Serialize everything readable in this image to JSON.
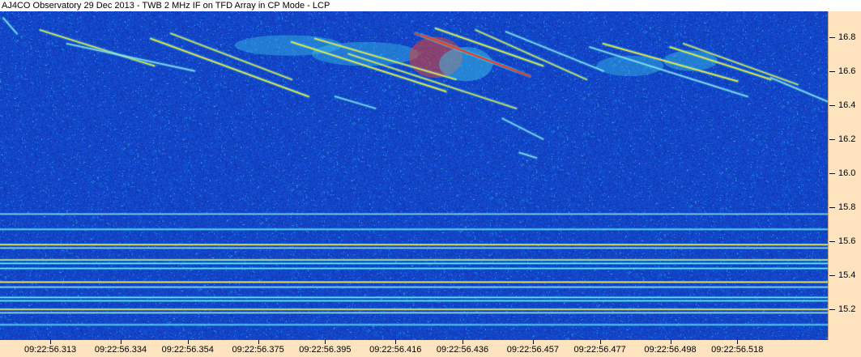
{
  "window": {
    "title": "AJ4CO Observatory 29 Dec 2013 - TWB 2 MHz IF on TFD Array in CP Mode - LCP"
  },
  "colors": {
    "background_blue": "#1a3fbf",
    "axis_panel": "#fde4bf",
    "emission_low": "#3cc8e6",
    "emission_mid": "#f0e640",
    "emission_high": "#e8402a"
  },
  "chart_data": {
    "type": "heatmap",
    "title": "AJ4CO Observatory 29 Dec 2013 - TWB 2 MHz IF on TFD Array in CP Mode - LCP",
    "xlabel": "",
    "ylabel": "",
    "x_ticks": [
      "09:22:56.313",
      "09:22:56.334",
      "09:22:56.354",
      "09:22:56.375",
      "09:22:56.395",
      "09:22:56.416",
      "09:22:56.436",
      "09:22:56.457",
      "09:22:56.477",
      "09:22:56.498",
      "09:22:56.518"
    ],
    "x_tick_seconds": [
      56.313,
      56.334,
      56.354,
      56.375,
      56.395,
      56.416,
      56.436,
      56.457,
      56.477,
      56.498,
      56.518
    ],
    "xlim": [
      56.298,
      56.545
    ],
    "y_ticks": [
      "15.2",
      "15.4",
      "15.6",
      "15.8",
      "16.0",
      "16.2",
      "16.4",
      "16.6",
      "16.8"
    ],
    "y_tick_values": [
      15.2,
      15.4,
      15.6,
      15.8,
      16.0,
      16.2,
      16.4,
      16.6,
      16.8
    ],
    "ylim": [
      15.02,
      16.95
    ],
    "y_units": "MHz",
    "grid": false,
    "colormap": "blue-cyan-yellow-red",
    "drifting_bursts": [
      {
        "t_start": 56.299,
        "f_start": 16.91,
        "t_end": 56.303,
        "f_end": 16.82,
        "intensity": 0.5
      },
      {
        "t_start": 56.31,
        "f_start": 16.84,
        "t_end": 56.344,
        "f_end": 16.63,
        "intensity": 0.7
      },
      {
        "t_start": 56.318,
        "f_start": 16.76,
        "t_end": 56.356,
        "f_end": 16.6,
        "intensity": 0.5
      },
      {
        "t_start": 56.343,
        "f_start": 16.79,
        "t_end": 56.39,
        "f_end": 16.45,
        "intensity": 0.8
      },
      {
        "t_start": 56.349,
        "f_start": 16.82,
        "t_end": 56.385,
        "f_end": 16.55,
        "intensity": 0.6
      },
      {
        "t_start": 56.385,
        "f_start": 16.77,
        "t_end": 56.431,
        "f_end": 16.48,
        "intensity": 0.8
      },
      {
        "t_start": 56.392,
        "f_start": 16.79,
        "t_end": 56.434,
        "f_end": 16.55,
        "intensity": 0.7
      },
      {
        "t_start": 56.402,
        "f_start": 16.7,
        "t_end": 56.452,
        "f_end": 16.38,
        "intensity": 0.6
      },
      {
        "t_start": 56.422,
        "f_start": 16.82,
        "t_end": 56.452,
        "f_end": 16.6,
        "intensity": 0.9
      },
      {
        "t_start": 56.424,
        "f_start": 16.81,
        "t_end": 56.456,
        "f_end": 16.57,
        "intensity": 1.0
      },
      {
        "t_start": 56.428,
        "f_start": 16.85,
        "t_end": 56.46,
        "f_end": 16.63,
        "intensity": 0.8
      },
      {
        "t_start": 56.44,
        "f_start": 16.84,
        "t_end": 56.473,
        "f_end": 16.55,
        "intensity": 0.6
      },
      {
        "t_start": 56.449,
        "f_start": 16.83,
        "t_end": 56.478,
        "f_end": 16.6,
        "intensity": 0.5
      },
      {
        "t_start": 56.478,
        "f_start": 16.76,
        "t_end": 56.518,
        "f_end": 16.54,
        "intensity": 0.8
      },
      {
        "t_start": 56.474,
        "f_start": 16.74,
        "t_end": 56.521,
        "f_end": 16.45,
        "intensity": 0.5
      },
      {
        "t_start": 56.498,
        "f_start": 16.74,
        "t_end": 56.528,
        "f_end": 16.55,
        "intensity": 0.8
      },
      {
        "t_start": 56.502,
        "f_start": 16.76,
        "t_end": 56.536,
        "f_end": 16.52,
        "intensity": 0.6
      },
      {
        "t_start": 56.528,
        "f_start": 16.56,
        "t_end": 56.545,
        "f_end": 16.42,
        "intensity": 0.5
      },
      {
        "t_start": 56.398,
        "f_start": 16.45,
        "t_end": 56.41,
        "f_end": 16.38,
        "intensity": 0.4
      },
      {
        "t_start": 56.448,
        "f_start": 16.32,
        "t_end": 56.46,
        "f_end": 16.2,
        "intensity": 0.4
      },
      {
        "t_start": 56.453,
        "f_start": 16.12,
        "t_end": 56.458,
        "f_end": 16.09,
        "intensity": 0.5
      }
    ],
    "emission_patches": [
      {
        "t": 56.384,
        "f": 16.75,
        "dt": 0.016,
        "df": 0.06,
        "intensity": 0.55
      },
      {
        "t": 56.407,
        "f": 16.7,
        "dt": 0.016,
        "df": 0.07,
        "intensity": 0.5
      },
      {
        "t": 56.428,
        "f": 16.68,
        "dt": 0.008,
        "df": 0.12,
        "intensity": 1.0
      },
      {
        "t": 56.437,
        "f": 16.64,
        "dt": 0.008,
        "df": 0.1,
        "intensity": 0.8
      },
      {
        "t": 56.486,
        "f": 16.63,
        "dt": 0.01,
        "df": 0.06,
        "intensity": 0.5
      },
      {
        "t": 56.504,
        "f": 16.66,
        "dt": 0.008,
        "df": 0.06,
        "intensity": 0.6
      }
    ],
    "horizontal_bands": [
      {
        "f": 15.76,
        "intensity": 0.35
      },
      {
        "f": 15.67,
        "intensity": 0.4
      },
      {
        "f": 15.58,
        "intensity": 0.85
      },
      {
        "f": 15.56,
        "intensity": 0.55
      },
      {
        "f": 15.49,
        "intensity": 0.75
      },
      {
        "f": 15.47,
        "intensity": 0.65
      },
      {
        "f": 15.44,
        "intensity": 0.55
      },
      {
        "f": 15.36,
        "intensity": 0.8
      },
      {
        "f": 15.33,
        "intensity": 0.7
      },
      {
        "f": 15.27,
        "intensity": 0.65
      },
      {
        "f": 15.25,
        "intensity": 0.6
      },
      {
        "f": 15.2,
        "intensity": 0.85
      },
      {
        "f": 15.18,
        "intensity": 0.6
      },
      {
        "f": 15.11,
        "intensity": 0.3
      }
    ]
  }
}
